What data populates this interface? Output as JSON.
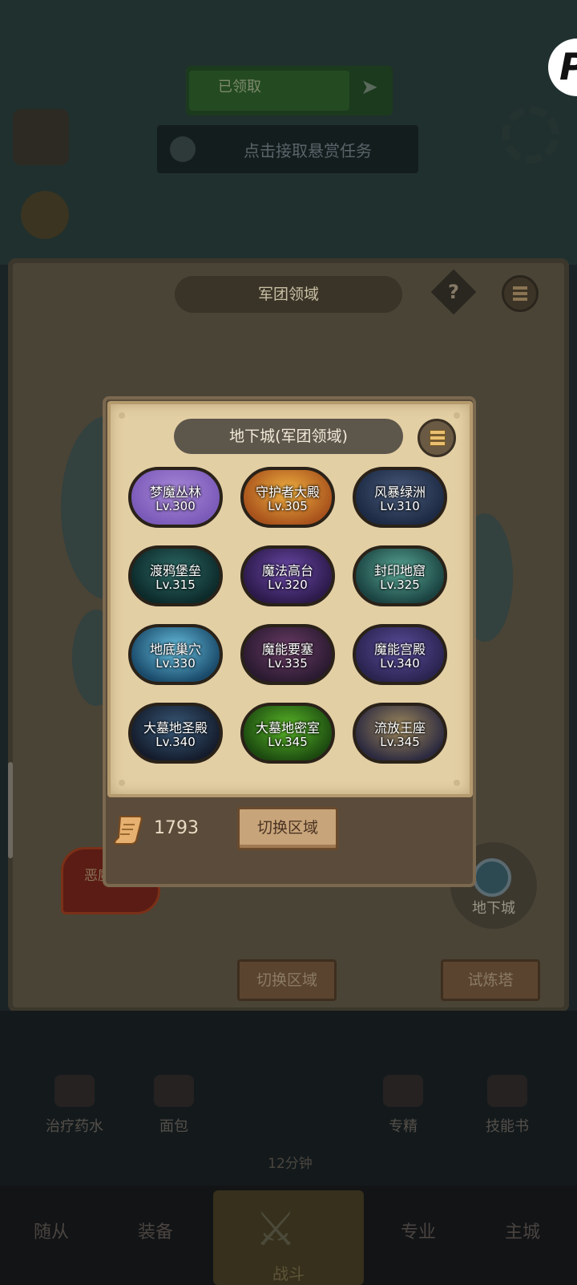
{
  "background": {
    "top_progress_label": "已领取",
    "quest_hint": "点击接取悬赏任务",
    "legion_title": "军团领域",
    "help_label": "?",
    "demon_tag": "恶魔\nLv.",
    "dungeon_button_label": "地下城",
    "switch_area_label": "切换区域",
    "trial_tower_label": "试炼塔",
    "bottom_items": [
      "治疗药水",
      "面包",
      "专精",
      "技能书"
    ],
    "timer_label": "12分钟",
    "tabs": [
      "随从",
      "装备",
      "战斗",
      "专业",
      "主城"
    ]
  },
  "modal": {
    "title": "地下城(军团领域)",
    "dungeons": [
      {
        "name": "梦魔丛林",
        "level": "Lv.300",
        "colors": [
          "#7a5ab8",
          "#a888d8"
        ]
      },
      {
        "name": "守护者大殿",
        "level": "Lv.305",
        "colors": [
          "#a8521c",
          "#f0b040"
        ]
      },
      {
        "name": "风暴绿洲",
        "level": "Lv.310",
        "colors": [
          "#1c2a44",
          "#4a5a7a"
        ]
      },
      {
        "name": "渡鸦堡垒",
        "level": "Lv.315",
        "colors": [
          "#0c2a2a",
          "#2e6a66"
        ]
      },
      {
        "name": "魔法高台",
        "level": "Lv.320",
        "colors": [
          "#2c1a4a",
          "#6a48a8"
        ]
      },
      {
        "name": "封印地窟",
        "level": "Lv.325",
        "colors": [
          "#1a4240",
          "#5aa896"
        ]
      },
      {
        "name": "地底巢穴",
        "level": "Lv.330",
        "colors": [
          "#1a4a6a",
          "#68c0e0"
        ]
      },
      {
        "name": "魔能要塞",
        "level": "Lv.335",
        "colors": [
          "#2a1a30",
          "#6a3c66"
        ]
      },
      {
        "name": "魔能宫殿",
        "level": "Lv.340",
        "colors": [
          "#2a2450",
          "#5a4c9a"
        ]
      },
      {
        "name": "大墓地圣殿",
        "level": "Lv.340",
        "colors": [
          "#141c2c",
          "#3a5a7a"
        ]
      },
      {
        "name": "大墓地密室",
        "level": "Lv.345",
        "colors": [
          "#1c4a10",
          "#5ab828"
        ]
      },
      {
        "name": "流放王座",
        "level": "Lv.345",
        "colors": [
          "#2c2a40",
          "#a08a5c"
        ]
      }
    ],
    "currency_value": "1793",
    "switch_area_label": "切换区域"
  }
}
